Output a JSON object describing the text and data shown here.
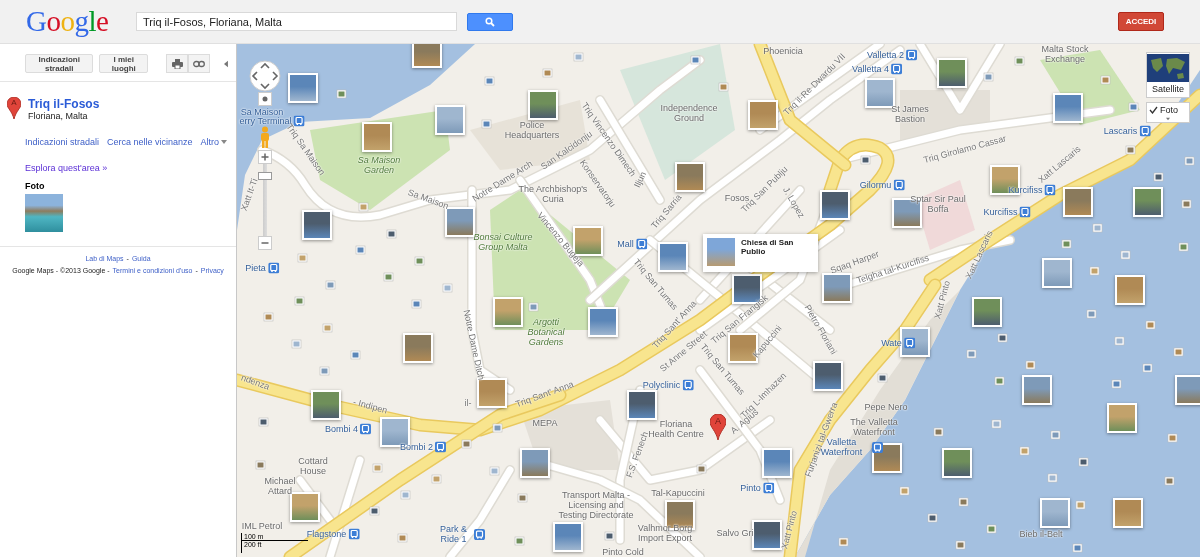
{
  "header": {
    "logo": "Google",
    "search": {
      "value": "Triq il-Fosos, Floriana, Malta"
    },
    "signin": "ACCEDI"
  },
  "panel": {
    "buttons": [
      "Indicazioni stradali",
      "I miei luoghi"
    ],
    "place": {
      "marker": "A",
      "title": "Triq il-Fosos",
      "subtitle": "Floriana, Malta"
    },
    "actions": [
      {
        "text": "Indicazioni stradali",
        "kind": "link"
      },
      {
        "text": "Cerca nelle vicinanze",
        "kind": "link"
      },
      {
        "text": "Altro",
        "kind": "menu"
      }
    ],
    "explore": "Esplora quest'area »",
    "photos_heading": "Foto",
    "footer": [
      [
        {
          "text": "Lab di Maps",
          "kind": "link"
        },
        {
          "text": "-",
          "kind": "text"
        },
        {
          "text": "Guida",
          "kind": "link"
        }
      ],
      [
        {
          "text": "Google Maps - ©2013 Google -",
          "kind": "text"
        },
        {
          "text": "Termini e condizioni d'uso",
          "kind": "link"
        },
        {
          "text": "-",
          "kind": "text"
        },
        {
          "text": "Privacy",
          "kind": "link"
        }
      ]
    ]
  },
  "map": {
    "zoom": {
      "level": 0.88
    },
    "map_types": [
      {
        "label": "Satellite",
        "kind": "thumbnail"
      },
      {
        "label": "Foto",
        "kind": "layer",
        "checked": true
      }
    ],
    "info_window": {
      "title": "Chiesa di San Publio"
    },
    "marker": "A",
    "scale": [
      "100 m",
      "200 ft"
    ],
    "labels": [
      {
        "text": "Phoenicia",
        "kind": "place"
      },
      {
        "text": "Valletta 2",
        "kind": "stop"
      },
      {
        "text": "Malta Stock Exchange",
        "kind": "place"
      },
      {
        "text": "Valletta 4",
        "kind": "stop"
      },
      {
        "text": "Triq il-Re Dwardu VII",
        "kind": "street"
      },
      {
        "text": "Sa Maison",
        "kind": "stop-name"
      },
      {
        "text": "erry Terminal",
        "kind": "stop"
      },
      {
        "text": "Independence Ground",
        "kind": "place"
      },
      {
        "text": "St James Bastion",
        "kind": "place"
      },
      {
        "text": "Police Headquarters",
        "kind": "place"
      },
      {
        "text": "Triq Vincenzo Dimech",
        "kind": "street"
      },
      {
        "text": "Lascaris",
        "kind": "stop"
      },
      {
        "text": "Triq Sa Maison",
        "kind": "street"
      },
      {
        "text": "Sa Maison Garden",
        "kind": "park"
      },
      {
        "text": "San Kalcidonju",
        "kind": "street"
      },
      {
        "text": "Iljun",
        "kind": "street"
      },
      {
        "text": "Triq Girolamo Cassar",
        "kind": "street"
      },
      {
        "text": "Xatt Lascaris",
        "kind": "street"
      },
      {
        "text": "Notre Dame Arch",
        "kind": "street"
      },
      {
        "text": "Konservatorju",
        "kind": "street"
      },
      {
        "text": "Gilormu",
        "kind": "stop"
      },
      {
        "text": "Xatt It-Ti",
        "kind": "street"
      },
      {
        "text": "Sa Maison",
        "kind": "street"
      },
      {
        "text": "The Archbishop's Curia",
        "kind": "place"
      },
      {
        "text": "Fosos",
        "kind": "place"
      },
      {
        "text": "Triq San Publju",
        "kind": "street"
      },
      {
        "text": "J. Lopez",
        "kind": "street"
      },
      {
        "text": "Sptar Sir Paul Boffa",
        "kind": "place"
      },
      {
        "text": "Kurcifiss",
        "kind": "stop"
      },
      {
        "text": "Triq Sarria",
        "kind": "street"
      },
      {
        "text": "Kurcifiss",
        "kind": "stop"
      },
      {
        "text": "Bonsai Culture Group Malta",
        "kind": "park"
      },
      {
        "text": "Vincenzo Bugeja",
        "kind": "street"
      },
      {
        "text": "Mall",
        "kind": "stop"
      },
      {
        "text": "Pieta",
        "kind": "stop"
      },
      {
        "text": "Triq San Tumas",
        "kind": "street"
      },
      {
        "text": "Sqaq Harper",
        "kind": "street"
      },
      {
        "text": "Telgha tal-Kurcifiss",
        "kind": "street"
      },
      {
        "text": "Xatt Lascaris",
        "kind": "street"
      },
      {
        "text": "Xatt Pinto",
        "kind": "street"
      },
      {
        "text": "Notre Dame Ditch",
        "kind": "street"
      },
      {
        "text": "Argotti Botanical Gardens",
        "kind": "park"
      },
      {
        "text": "Triq Sant' Anna",
        "kind": "street"
      },
      {
        "text": "Triq San Frangisk",
        "kind": "street"
      },
      {
        "text": "Kapuccini",
        "kind": "street"
      },
      {
        "text": "Pietro Floriani",
        "kind": "street"
      },
      {
        "text": "Wate",
        "kind": "stop"
      },
      {
        "text": "St Anne Street",
        "kind": "street"
      },
      {
        "text": "Triq San Tumas",
        "kind": "street"
      },
      {
        "text": "ndenza",
        "kind": "street"
      },
      {
        "text": "Polyclinic",
        "kind": "stop"
      },
      {
        "text": "Triq L-Imhazen",
        "kind": "street"
      },
      {
        "text": "- Indipen",
        "kind": "street"
      },
      {
        "text": "il-",
        "kind": "street"
      },
      {
        "text": "Triq Sant' Anna",
        "kind": "street"
      },
      {
        "text": "Pepe Nero",
        "kind": "place"
      },
      {
        "text": "Bombi 4",
        "kind": "stop"
      },
      {
        "text": "MEPA",
        "kind": "place"
      },
      {
        "text": "Floriana Health Centre",
        "kind": "place"
      },
      {
        "text": "A. Agius",
        "kind": "street"
      },
      {
        "text": "The Valletta Waterfront",
        "kind": "place"
      },
      {
        "text": "Bombi 2",
        "kind": "stop"
      },
      {
        "text": "F.S. Fenech",
        "kind": "street"
      },
      {
        "text": "Furjanizi tal-Gwerra",
        "kind": "street"
      },
      {
        "text": "Valletta Waterfront",
        "kind": "stop"
      },
      {
        "text": "Cottard House",
        "kind": "place"
      },
      {
        "text": "Michael Attard",
        "kind": "place"
      },
      {
        "text": "Tal-Kapuccini",
        "kind": "place"
      },
      {
        "text": "Pinto",
        "kind": "stop"
      },
      {
        "text": "Transport Malta - Licensing and Testing Directorate",
        "kind": "place"
      },
      {
        "text": "IML Petrol",
        "kind": "place"
      },
      {
        "text": "Flagstone",
        "kind": "stop"
      },
      {
        "text": "Park & Ride 1",
        "kind": "stop"
      },
      {
        "text": "Valhmor Borg Import Export",
        "kind": "place"
      },
      {
        "text": "Salvo Gri",
        "kind": "place"
      },
      {
        "text": "Xatt Pinto",
        "kind": "street"
      },
      {
        "text": "Bieb il-Belt",
        "kind": "place"
      },
      {
        "text": "Pinto Cold",
        "kind": "place"
      }
    ]
  }
}
